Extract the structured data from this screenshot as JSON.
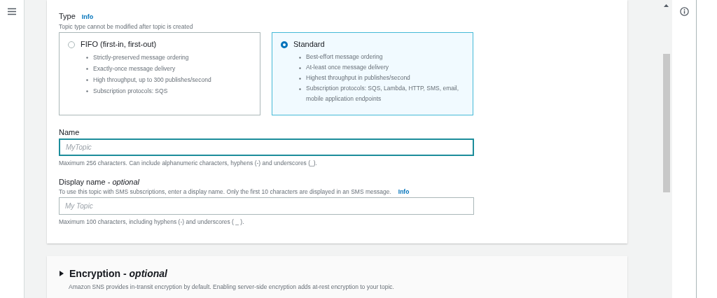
{
  "type_section": {
    "label": "Type",
    "info_link": "Info",
    "description": "Topic type cannot be modified after topic is created",
    "options": [
      {
        "title": "FIFO (first-in, first-out)",
        "selected": false,
        "features": [
          "Strictly-preserved message ordering",
          "Exactly-once message delivery",
          "High throughput, up to 300 publishes/second",
          "Subscription protocols: SQS"
        ]
      },
      {
        "title": "Standard",
        "selected": true,
        "features": [
          "Best-effort message ordering",
          "At-least once message delivery",
          "Highest throughput in publishes/second",
          "Subscription protocols: SQS, Lambda, HTTP, SMS, email, mobile application endpoints"
        ]
      }
    ]
  },
  "fields": [
    {
      "label": "Name",
      "placeholder": "MyTopic",
      "focused": true,
      "help": "Maximum 256 characters. Can include alphanumeric characters, hyphens (-) and underscores (_)."
    },
    {
      "label": "Display name - ",
      "optional_suffix": "optional",
      "description": "To use this topic with SMS subscriptions, enter a display name. Only the first 10 characters are displayed in an SMS message.",
      "info_link": "Info",
      "placeholder": "My Topic",
      "focused": false,
      "help": "Maximum 100 characters, including hyphens (-) and underscores ( _ )."
    }
  ],
  "encryption": {
    "title": "Encryption - ",
    "optional_suffix": "optional",
    "expanded": false,
    "description": "Amazon SNS provides in-transit encryption by default. Enabling server-side encryption adds at-rest encryption to your topic."
  }
}
